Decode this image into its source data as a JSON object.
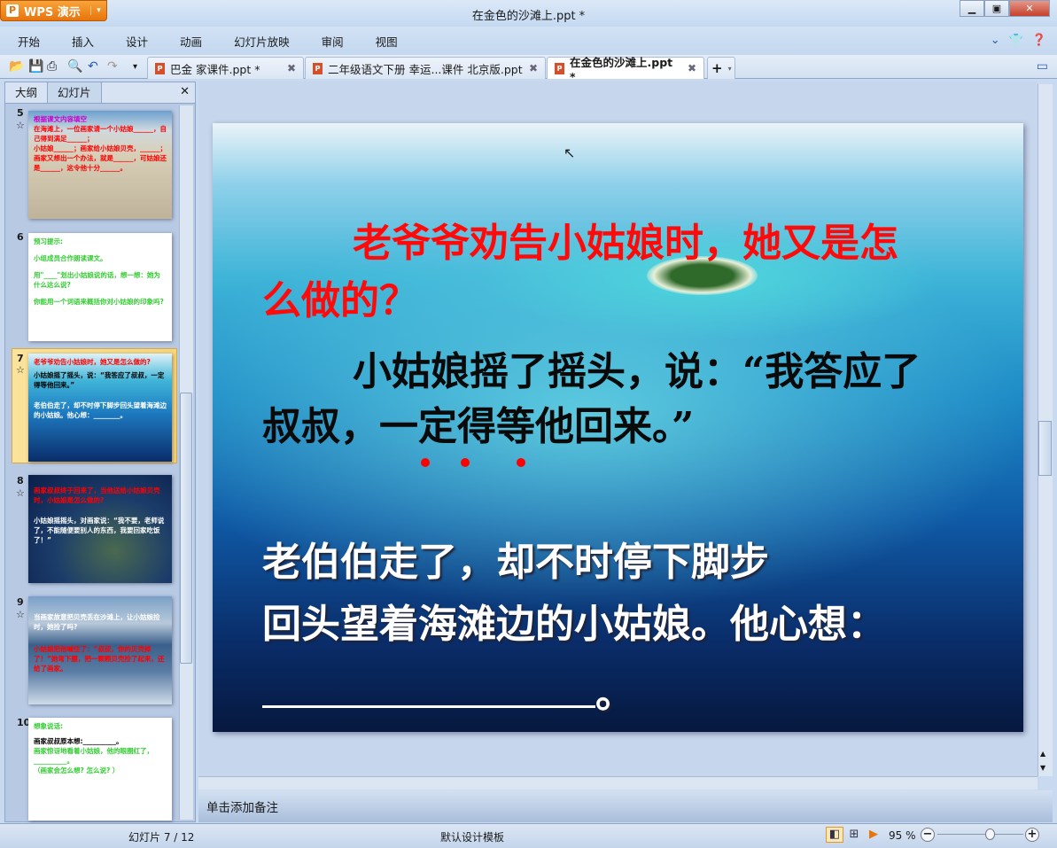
{
  "app": {
    "name": "WPS 演示",
    "title": "在金色的沙滩上.ppt *"
  },
  "menu": [
    "开始",
    "插入",
    "设计",
    "动画",
    "幻灯片放映",
    "审阅",
    "视图"
  ],
  "tabs": [
    {
      "label": "巴金  家课件.ppt *",
      "active": false
    },
    {
      "label": "二年级语文下册 幸运...课件 北京版.ppt",
      "active": false
    },
    {
      "label": "在金色的沙滩上.ppt *",
      "active": true
    }
  ],
  "panel": {
    "tabs": [
      "大纲",
      "幻灯片"
    ],
    "active_tab": "幻灯片"
  },
  "thumbnails": [
    {
      "num": "5",
      "lines": [
        "根据课文内容填空",
        "在海滩上，一位画家请一个小姑娘______，自己得到满足______；",
        "小姑娘______；画家给小姑娘贝壳，______；画家又想出一个办法，就是______，可姑娘还是______，这令他十分______。"
      ]
    },
    {
      "num": "6",
      "lines": [
        "预习提示:",
        "小组成员合作朗读课文。",
        "用\"____\"划出小姑娘说的话，想一想：她为什么这么说?",
        "你能用一个词语来概括你对小姑娘的印象吗?"
      ]
    },
    {
      "num": "7",
      "lines": [
        "老爷爷劝告小姑娘时，她又是怎么做的?",
        "小姑娘摇了摇头，说：“我答应了叔叔，一定得等他回来。”",
        "老伯伯走了，却不时停下脚步回头望着海滩边的小姑娘。他心想：________。"
      ]
    },
    {
      "num": "8",
      "lines": [
        "画家叔叔终于回来了，当他送给小姑娘贝壳时，小姑娘是怎么做的?",
        "小姑娘摇摇头，对画家说：“我不要，老师说了，不能随便要别人的东西，我要回家吃饭了！”"
      ]
    },
    {
      "num": "9",
      "lines": [
        "当画家故意把贝壳丢在沙滩上，让小姑娘捡时，她捡了吗?",
        "小姑娘把他喊住了：“叔叔，你的贝壳掉了！”她弯下腰，把一颗颗贝壳捡了起来，还给了画家。"
      ]
    },
    {
      "num": "10",
      "lines": [
        "想象说话:",
        "画家叔叔原本想:__________。",
        "画家惊讶地看着小姑娘，他的眼圈红了，__________。",
        "（画家会怎么想? 怎么说? ）"
      ]
    }
  ],
  "slide": {
    "q_line1": "老爷爷劝告小姑娘时，她又是怎",
    "q_line2": "么做的？",
    "a_line1": "小姑娘摇了摇头，说：“我答应了",
    "a_line2": "叔叔，一定得等他回来。”",
    "w_line1": "老伯伯走了，却不时停下脚步",
    "w_line2": "回头望着海滩边的小姑娘。他心想：",
    "blank_end": "。",
    "colors": {
      "question": "#ff0a0a",
      "answer": "#0a0a0a",
      "narration": "#ffffff"
    }
  },
  "notes_placeholder": "单击添加备注",
  "status": {
    "slide_counter": "幻灯片 7 / 12",
    "template": "默认设计模板",
    "zoom": "95 %",
    "zoom_level_percent": 95
  }
}
